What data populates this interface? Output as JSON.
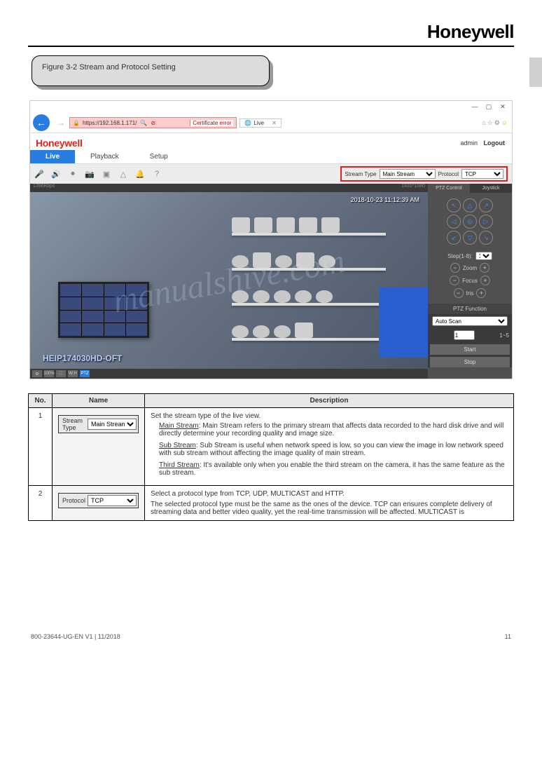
{
  "brand": "Honeywell",
  "note_title": "Figure 3-2    Stream and Protocol Setting",
  "screenshot": {
    "titlebar": {
      "min": "—",
      "max": "▢",
      "close": "✕"
    },
    "addr": {
      "url": "https://192.168.1.171/",
      "cert": "Certificate error",
      "tab_label": "Live",
      "icons": {
        "home": "⌂",
        "star": "☆",
        "gear": "⚙",
        "smile": "☺"
      }
    },
    "logo": "Honeywell",
    "user": "admin",
    "logout": "Logout",
    "nav": {
      "live": "Live",
      "playback": "Playback",
      "setup": "Setup"
    },
    "toolbar": {
      "stream_label": "Stream Type",
      "stream_value": "Main Stream",
      "protocol_label": "Protocol",
      "protocol_value": "TCP"
    },
    "video": {
      "top_left": "1396Kbps",
      "top_right": "1920*1080",
      "timestamp": "2018-10-23 11:12:39 AM",
      "camera_name": "HEIP174030HD-OFT",
      "ptz_badge": "PTZ"
    },
    "ptz": {
      "tab_control": "PTZ Control",
      "tab_joystick": "Joystick",
      "step_label": "Step(1-8):",
      "step_value": "1",
      "zoom": "Zoom",
      "focus": "Focus",
      "iris": "Iris",
      "func_title": "PTZ Function",
      "func_select": "Auto Scan",
      "func_num": "1",
      "func_range": "1~5",
      "start": "Start",
      "stop": "Stop"
    }
  },
  "watermark": "manualshive.com",
  "table": {
    "headers": {
      "no": "No.",
      "name": "Name",
      "desc": "Description"
    },
    "rows": [
      {
        "no": "1",
        "ctrl_label": "Stream Type",
        "ctrl_value": "Main Stream",
        "desc_intro": "Set the stream type of the live view.",
        "options": [
          {
            "name": "Main Stream",
            "text": ": Main Stream refers to the primary stream that affects data recorded to the hard disk drive and will directly determine your recording quality and image size."
          },
          {
            "name": "Sub Stream",
            "text": ": Sub Stream is useful when network speed is low, so you can view the image in low network speed with sub stream without affecting the image quality of main stream."
          },
          {
            "name": "Third Stream",
            "text": ": It's available only when you enable the third stream on the camera, it has the same feature as the sub stream."
          }
        ]
      },
      {
        "no": "2",
        "ctrl_label": "Protocol",
        "ctrl_value": "TCP",
        "desc_intro": "Select a protocol type from TCP, UDP, MULTICAST and HTTP.",
        "desc_extra": "The selected protocol type must be the same as the ones of the device. TCP can ensures complete delivery of streaming data and better video quality, yet the real-time transmission will be affected. MULTICAST is"
      }
    ]
  },
  "footer": {
    "left": "800-23644-UG-EN V1 | 11/2018",
    "right": "11"
  }
}
